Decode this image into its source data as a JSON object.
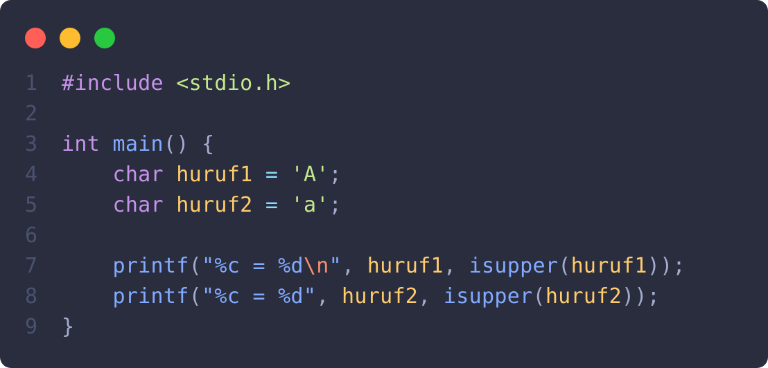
{
  "window": {
    "background": "#292d3e",
    "dots": [
      {
        "name": "close",
        "color": "#ff5f57"
      },
      {
        "name": "minimize",
        "color": "#febc2e"
      },
      {
        "name": "maximize",
        "color": "#28c840"
      }
    ]
  },
  "colors": {
    "default": "#a6accd",
    "line_number": "#4b5270",
    "keyword": "#c792ea",
    "function": "#82aaff",
    "variable": "#ffcb6b",
    "string": "#c3e88d",
    "escape": "#f78c6c",
    "operator": "#89ddff",
    "punctuation": "#a6accd"
  },
  "code": {
    "lines": [
      {
        "number": "1",
        "tokens": [
          {
            "text": "#include",
            "kind": "keyword"
          },
          {
            "text": " ",
            "kind": "default"
          },
          {
            "text": "<stdio.h>",
            "kind": "string"
          }
        ]
      },
      {
        "number": "2",
        "tokens": []
      },
      {
        "number": "3",
        "tokens": [
          {
            "text": "int",
            "kind": "keyword"
          },
          {
            "text": " ",
            "kind": "default"
          },
          {
            "text": "main",
            "kind": "function"
          },
          {
            "text": "() {",
            "kind": "punctuation"
          }
        ]
      },
      {
        "number": "4",
        "tokens": [
          {
            "text": "    ",
            "kind": "default"
          },
          {
            "text": "char",
            "kind": "keyword"
          },
          {
            "text": " ",
            "kind": "default"
          },
          {
            "text": "huruf1",
            "kind": "variable"
          },
          {
            "text": " ",
            "kind": "default"
          },
          {
            "text": "=",
            "kind": "operator"
          },
          {
            "text": " ",
            "kind": "default"
          },
          {
            "text": "'A'",
            "kind": "string"
          },
          {
            "text": ";",
            "kind": "punctuation"
          }
        ]
      },
      {
        "number": "5",
        "tokens": [
          {
            "text": "    ",
            "kind": "default"
          },
          {
            "text": "char",
            "kind": "keyword"
          },
          {
            "text": " ",
            "kind": "default"
          },
          {
            "text": "huruf2",
            "kind": "variable"
          },
          {
            "text": " ",
            "kind": "default"
          },
          {
            "text": "=",
            "kind": "operator"
          },
          {
            "text": " ",
            "kind": "default"
          },
          {
            "text": "'a'",
            "kind": "string"
          },
          {
            "text": ";",
            "kind": "punctuation"
          }
        ]
      },
      {
        "number": "6",
        "tokens": []
      },
      {
        "number": "7",
        "tokens": [
          {
            "text": "    ",
            "kind": "default"
          },
          {
            "text": "printf",
            "kind": "function"
          },
          {
            "text": "(",
            "kind": "punctuation"
          },
          {
            "text": "\"%c = %d",
            "kind": "function"
          },
          {
            "text": "\\n",
            "kind": "escape"
          },
          {
            "text": "\"",
            "kind": "function"
          },
          {
            "text": ", ",
            "kind": "punctuation"
          },
          {
            "text": "huruf1",
            "kind": "variable"
          },
          {
            "text": ", ",
            "kind": "punctuation"
          },
          {
            "text": "isupper",
            "kind": "function"
          },
          {
            "text": "(",
            "kind": "punctuation"
          },
          {
            "text": "huruf1",
            "kind": "variable"
          },
          {
            "text": "));",
            "kind": "punctuation"
          }
        ]
      },
      {
        "number": "8",
        "tokens": [
          {
            "text": "    ",
            "kind": "default"
          },
          {
            "text": "printf",
            "kind": "function"
          },
          {
            "text": "(",
            "kind": "punctuation"
          },
          {
            "text": "\"%c = %d\"",
            "kind": "function"
          },
          {
            "text": ", ",
            "kind": "punctuation"
          },
          {
            "text": "huruf2",
            "kind": "variable"
          },
          {
            "text": ", ",
            "kind": "punctuation"
          },
          {
            "text": "isupper",
            "kind": "function"
          },
          {
            "text": "(",
            "kind": "punctuation"
          },
          {
            "text": "huruf2",
            "kind": "variable"
          },
          {
            "text": "));",
            "kind": "punctuation"
          }
        ]
      },
      {
        "number": "9",
        "tokens": [
          {
            "text": "}",
            "kind": "punctuation"
          }
        ]
      }
    ]
  }
}
